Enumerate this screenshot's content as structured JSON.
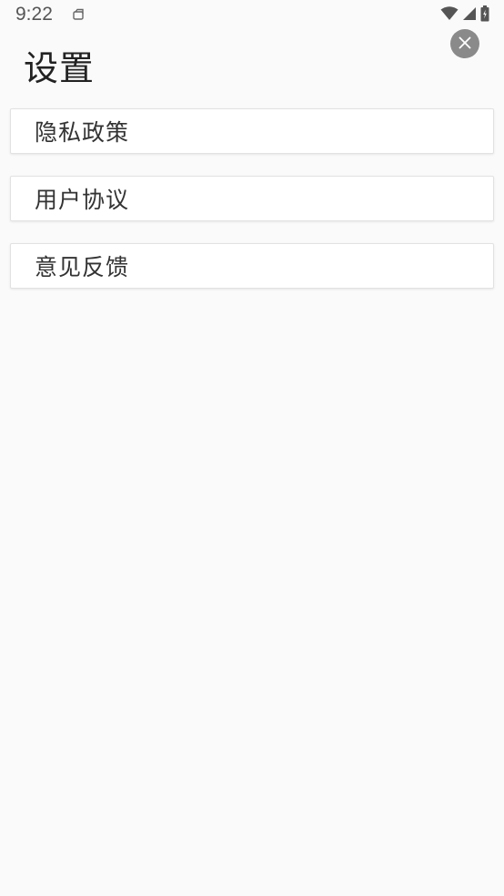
{
  "status_bar": {
    "time": "9:22",
    "icons": [
      "notification-icon",
      "wifi-icon",
      "signal-icon",
      "battery-icon"
    ]
  },
  "header": {
    "title": "设置",
    "close_icon": "close-icon"
  },
  "menu": {
    "items": [
      {
        "label": "隐私政策"
      },
      {
        "label": "用户协议"
      },
      {
        "label": "意见反馈"
      }
    ]
  },
  "colors": {
    "background": "#fafafa",
    "card": "#ffffff",
    "close_button": "#8a8a8a"
  }
}
